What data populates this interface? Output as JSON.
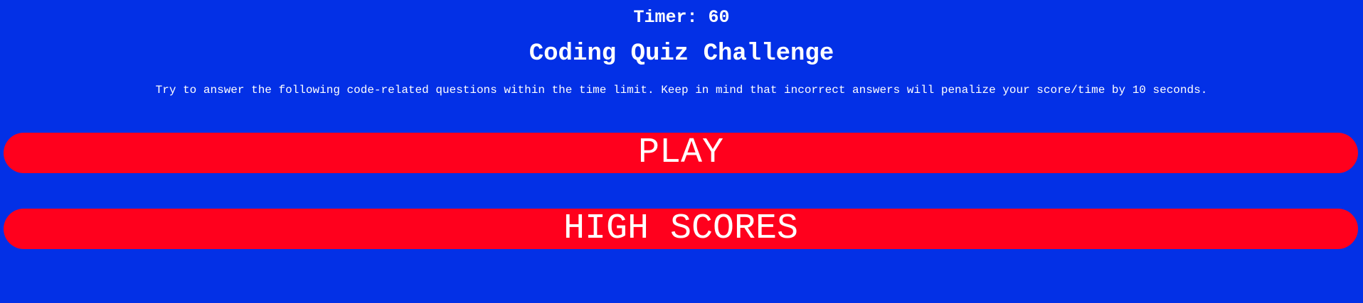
{
  "header": {
    "timer_label": "Timer: ",
    "timer_value": "60"
  },
  "main": {
    "title": "Coding Quiz Challenge",
    "instructions": "Try to answer the following code-related questions within the time limit. Keep in mind that incorrect answers will penalize your score/time by 10 seconds."
  },
  "buttons": {
    "play_label": "PLAY",
    "high_scores_label": "HIGH SCORES"
  },
  "colors": {
    "background": "#0330e6",
    "button": "#ff001d",
    "text": "#ffffff"
  }
}
